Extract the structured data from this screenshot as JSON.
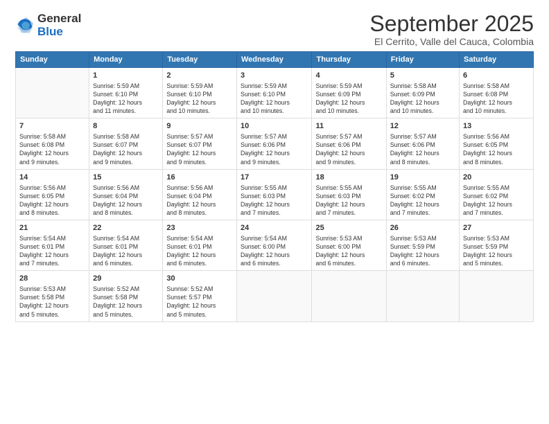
{
  "logo": {
    "line1": "General",
    "line2": "Blue"
  },
  "title": "September 2025",
  "location": "El Cerrito, Valle del Cauca, Colombia",
  "days_of_week": [
    "Sunday",
    "Monday",
    "Tuesday",
    "Wednesday",
    "Thursday",
    "Friday",
    "Saturday"
  ],
  "weeks": [
    [
      {
        "num": "",
        "detail": ""
      },
      {
        "num": "1",
        "detail": "Sunrise: 5:59 AM\nSunset: 6:10 PM\nDaylight: 12 hours\nand 11 minutes."
      },
      {
        "num": "2",
        "detail": "Sunrise: 5:59 AM\nSunset: 6:10 PM\nDaylight: 12 hours\nand 10 minutes."
      },
      {
        "num": "3",
        "detail": "Sunrise: 5:59 AM\nSunset: 6:10 PM\nDaylight: 12 hours\nand 10 minutes."
      },
      {
        "num": "4",
        "detail": "Sunrise: 5:59 AM\nSunset: 6:09 PM\nDaylight: 12 hours\nand 10 minutes."
      },
      {
        "num": "5",
        "detail": "Sunrise: 5:58 AM\nSunset: 6:09 PM\nDaylight: 12 hours\nand 10 minutes."
      },
      {
        "num": "6",
        "detail": "Sunrise: 5:58 AM\nSunset: 6:08 PM\nDaylight: 12 hours\nand 10 minutes."
      }
    ],
    [
      {
        "num": "7",
        "detail": "Sunrise: 5:58 AM\nSunset: 6:08 PM\nDaylight: 12 hours\nand 9 minutes."
      },
      {
        "num": "8",
        "detail": "Sunrise: 5:58 AM\nSunset: 6:07 PM\nDaylight: 12 hours\nand 9 minutes."
      },
      {
        "num": "9",
        "detail": "Sunrise: 5:57 AM\nSunset: 6:07 PM\nDaylight: 12 hours\nand 9 minutes."
      },
      {
        "num": "10",
        "detail": "Sunrise: 5:57 AM\nSunset: 6:06 PM\nDaylight: 12 hours\nand 9 minutes."
      },
      {
        "num": "11",
        "detail": "Sunrise: 5:57 AM\nSunset: 6:06 PM\nDaylight: 12 hours\nand 9 minutes."
      },
      {
        "num": "12",
        "detail": "Sunrise: 5:57 AM\nSunset: 6:06 PM\nDaylight: 12 hours\nand 8 minutes."
      },
      {
        "num": "13",
        "detail": "Sunrise: 5:56 AM\nSunset: 6:05 PM\nDaylight: 12 hours\nand 8 minutes."
      }
    ],
    [
      {
        "num": "14",
        "detail": "Sunrise: 5:56 AM\nSunset: 6:05 PM\nDaylight: 12 hours\nand 8 minutes."
      },
      {
        "num": "15",
        "detail": "Sunrise: 5:56 AM\nSunset: 6:04 PM\nDaylight: 12 hours\nand 8 minutes."
      },
      {
        "num": "16",
        "detail": "Sunrise: 5:56 AM\nSunset: 6:04 PM\nDaylight: 12 hours\nand 8 minutes."
      },
      {
        "num": "17",
        "detail": "Sunrise: 5:55 AM\nSunset: 6:03 PM\nDaylight: 12 hours\nand 7 minutes."
      },
      {
        "num": "18",
        "detail": "Sunrise: 5:55 AM\nSunset: 6:03 PM\nDaylight: 12 hours\nand 7 minutes."
      },
      {
        "num": "19",
        "detail": "Sunrise: 5:55 AM\nSunset: 6:02 PM\nDaylight: 12 hours\nand 7 minutes."
      },
      {
        "num": "20",
        "detail": "Sunrise: 5:55 AM\nSunset: 6:02 PM\nDaylight: 12 hours\nand 7 minutes."
      }
    ],
    [
      {
        "num": "21",
        "detail": "Sunrise: 5:54 AM\nSunset: 6:01 PM\nDaylight: 12 hours\nand 7 minutes."
      },
      {
        "num": "22",
        "detail": "Sunrise: 5:54 AM\nSunset: 6:01 PM\nDaylight: 12 hours\nand 6 minutes."
      },
      {
        "num": "23",
        "detail": "Sunrise: 5:54 AM\nSunset: 6:01 PM\nDaylight: 12 hours\nand 6 minutes."
      },
      {
        "num": "24",
        "detail": "Sunrise: 5:54 AM\nSunset: 6:00 PM\nDaylight: 12 hours\nand 6 minutes."
      },
      {
        "num": "25",
        "detail": "Sunrise: 5:53 AM\nSunset: 6:00 PM\nDaylight: 12 hours\nand 6 minutes."
      },
      {
        "num": "26",
        "detail": "Sunrise: 5:53 AM\nSunset: 5:59 PM\nDaylight: 12 hours\nand 6 minutes."
      },
      {
        "num": "27",
        "detail": "Sunrise: 5:53 AM\nSunset: 5:59 PM\nDaylight: 12 hours\nand 5 minutes."
      }
    ],
    [
      {
        "num": "28",
        "detail": "Sunrise: 5:53 AM\nSunset: 5:58 PM\nDaylight: 12 hours\nand 5 minutes."
      },
      {
        "num": "29",
        "detail": "Sunrise: 5:52 AM\nSunset: 5:58 PM\nDaylight: 12 hours\nand 5 minutes."
      },
      {
        "num": "30",
        "detail": "Sunrise: 5:52 AM\nSunset: 5:57 PM\nDaylight: 12 hours\nand 5 minutes."
      },
      {
        "num": "",
        "detail": ""
      },
      {
        "num": "",
        "detail": ""
      },
      {
        "num": "",
        "detail": ""
      },
      {
        "num": "",
        "detail": ""
      }
    ]
  ]
}
